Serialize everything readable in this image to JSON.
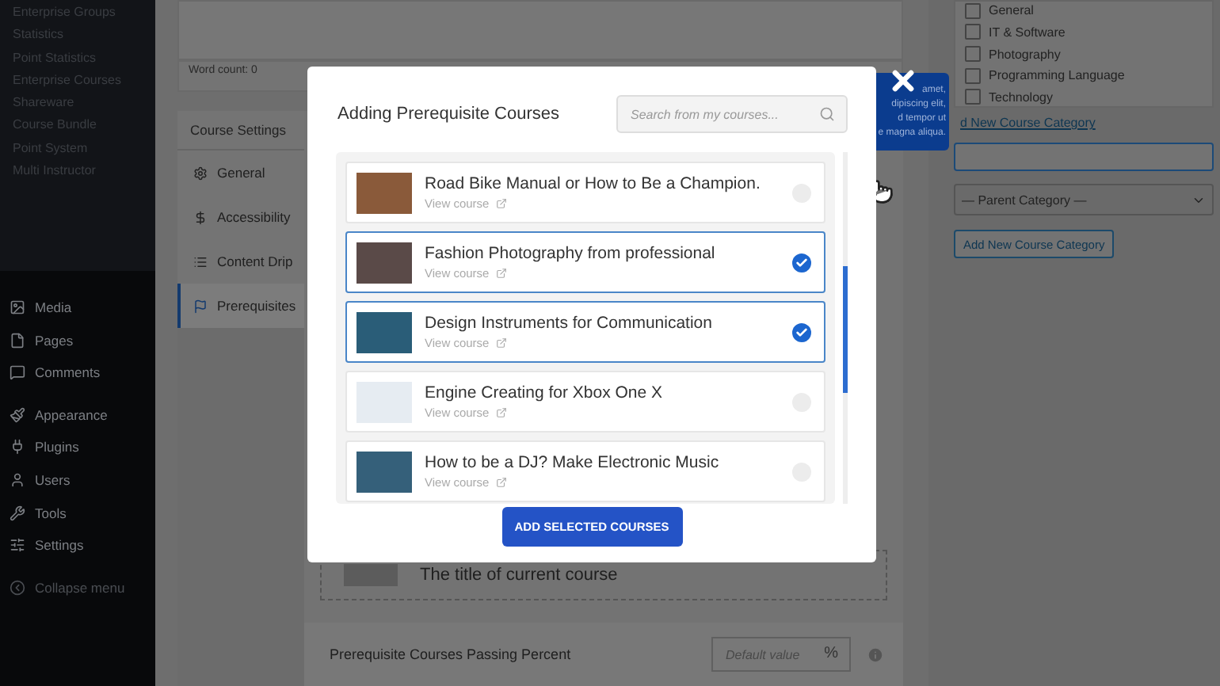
{
  "sidebar": {
    "plugin_items": [
      "Enterprise Groups",
      "Statistics",
      "Point Statistics",
      "Enterprise Courses",
      "Shareware",
      "Course Bundle",
      "Point System",
      "Multi Instructor"
    ],
    "menu": [
      {
        "label": "Media"
      },
      {
        "label": "Pages"
      },
      {
        "label": "Comments"
      },
      {
        "label": "Appearance"
      },
      {
        "label": "Plugins"
      },
      {
        "label": "Users"
      },
      {
        "label": "Tools"
      },
      {
        "label": "Settings"
      },
      {
        "label": "Collapse menu"
      }
    ]
  },
  "editor": {
    "word_count": "Word count: 0"
  },
  "course_settings": {
    "title": "Course Settings",
    "tabs": [
      {
        "label": "General",
        "selected": false
      },
      {
        "label": "Accessibility",
        "selected": false
      },
      {
        "label": "Content Drip",
        "selected": false
      },
      {
        "label": "Prerequisites",
        "selected": true
      }
    ]
  },
  "current_course": {
    "title": "The title of current course"
  },
  "passing_percent": {
    "label": "Prerequisite Courses Passing Percent",
    "placeholder": "Default value",
    "suffix": "%"
  },
  "categories": {
    "items": [
      {
        "label": "General",
        "checked": false
      },
      {
        "label": "IT & Software",
        "checked": false
      },
      {
        "label": "Photography",
        "checked": false
      },
      {
        "label": "Programming Language",
        "checked": false
      },
      {
        "label": "Technology",
        "checked": false
      }
    ],
    "add_link": "d New Course Category",
    "parent_select": "— Parent Category —",
    "add_button": "Add New Course Category"
  },
  "tooltip": {
    "lines": [
      "amet,",
      "dipiscing elit,",
      "d tempor ut",
      "e magna aliqua."
    ]
  },
  "modal": {
    "title": "Adding Prerequisite Courses",
    "search_placeholder": "Search from my courses...",
    "courses": [
      {
        "title": "Road Bike Manual or How to Be a Champion.",
        "link": "View course",
        "selected": false
      },
      {
        "title": "Fashion Photography from professional",
        "link": "View course",
        "selected": true
      },
      {
        "title": "Design Instruments for Communication",
        "link": "View course",
        "selected": true
      },
      {
        "title": "Engine Creating for Xbox One X",
        "link": "View course",
        "selected": false
      },
      {
        "title": "How to be a DJ? Make Electronic Music",
        "link": "View course",
        "selected": false
      }
    ],
    "button": "ADD SELECTED COURSES"
  }
}
